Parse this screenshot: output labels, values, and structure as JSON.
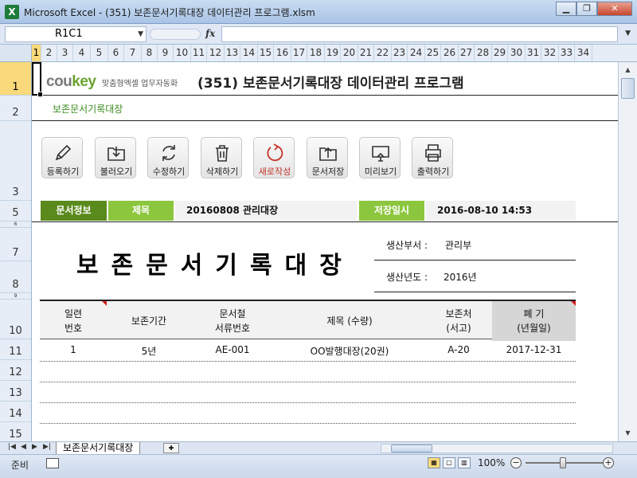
{
  "window": {
    "title": "Microsoft Excel - (351) 보존문서기록대장 데이터관리 프로그램.xlsm",
    "icon": "excel-icon"
  },
  "formula_bar": {
    "name_box": "R1C1",
    "fx": "fx",
    "value": ""
  },
  "columns": [
    "1",
    "2",
    "3",
    "4",
    "5",
    "6",
    "7",
    "8",
    "9",
    "10",
    "11",
    "12",
    "13",
    "14",
    "15",
    "16",
    "17",
    "18",
    "19",
    "20",
    "21",
    "22",
    "23",
    "24",
    "25",
    "26",
    "27",
    "28",
    "29",
    "30",
    "31",
    "32",
    "33",
    "34"
  ],
  "rows": [
    {
      "label": "1"
    },
    {
      "label": "2"
    },
    {
      "label": "3"
    },
    {
      "label": "5"
    },
    {
      "label": "6"
    },
    {
      "label": "7"
    },
    {
      "label": "8"
    },
    {
      "label": "9"
    },
    {
      "label": "10"
    },
    {
      "label": "11"
    },
    {
      "label": "12"
    },
    {
      "label": "13"
    },
    {
      "label": "14"
    },
    {
      "label": "15"
    }
  ],
  "brand": {
    "cou": "cou",
    "key": "key",
    "tagline": "맞춤형엑셀 업무자동화"
  },
  "main_title": "(351) 보존문서기록대장 데이터관리 프로그램",
  "subtitle": "보존문서기록대장",
  "toolbar": [
    {
      "label": "등록하기",
      "icon": "pencil-icon"
    },
    {
      "label": "불러오기",
      "icon": "download-folder-icon"
    },
    {
      "label": "수정하기",
      "icon": "refresh-icon"
    },
    {
      "label": "삭제하기",
      "icon": "trash-icon"
    },
    {
      "label": "새로작성",
      "icon": "new-circle-icon"
    },
    {
      "label": "문서저장",
      "icon": "upload-folder-icon"
    },
    {
      "label": "미리보기",
      "icon": "monitor-icon"
    },
    {
      "label": "출력하기",
      "icon": "printer-icon"
    }
  ],
  "info": {
    "section_label": "문서정보",
    "title_label": "제목",
    "title_value": "20160808 관리대장",
    "saved_label": "저장일시",
    "saved_value": "2016-08-10 14:53"
  },
  "document": {
    "heading": "보존문서기록대장",
    "dept_label": "생산부서 :",
    "dept_value": "관리부",
    "year_label": "생산년도 :",
    "year_value": "2016년"
  },
  "table": {
    "headers": [
      "일련\n번호",
      "보존기간",
      "문서철\n서류번호",
      "제목 (수량)",
      "보존처\n(서고)",
      "폐    기\n(년월일)"
    ],
    "rows": [
      [
        "1",
        "5년",
        "AE-001",
        "OO발행대장(20권)",
        "A-20",
        "2017-12-31"
      ]
    ]
  },
  "sheet_tabs": [
    "보존문서기록대장"
  ],
  "status": {
    "ready": "준비",
    "zoom": "100%"
  },
  "colors": {
    "accent_dark": "#5a8a1c",
    "accent_light": "#8cc63e",
    "red": "#c4322a",
    "select": "#f9d97a"
  }
}
